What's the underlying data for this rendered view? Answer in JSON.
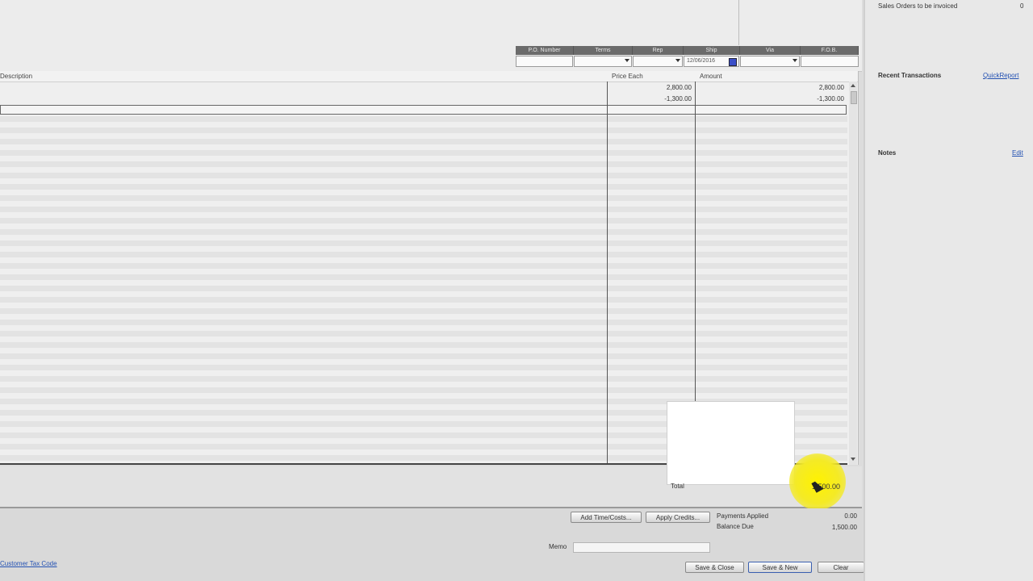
{
  "header_fields": {
    "labels": [
      "P.O. Number",
      "Terms",
      "Rep",
      "Ship",
      "Via",
      "F.O.B."
    ],
    "ship_date": "12/06/2016"
  },
  "grid": {
    "columns": {
      "description": "Description",
      "price_each": "Price Each",
      "amount": "Amount"
    },
    "rows": [
      {
        "price_each": "2,800.00",
        "amount": "2,800.00"
      },
      {
        "price_each": "-1,300.00",
        "amount": "-1,300.00"
      }
    ]
  },
  "totals": {
    "total_label": "Total",
    "total_value": "1,500.00",
    "payments_applied_label": "Payments Applied",
    "payments_applied_value": "0.00",
    "balance_due_label": "Balance Due",
    "balance_due_value": "1,500.00"
  },
  "buttons": {
    "add_time_costs": "Add Time/Costs...",
    "apply_credits": "Apply Credits...",
    "save_close": "Save & Close",
    "save_new": "Save & New",
    "clear": "Clear"
  },
  "memo": {
    "label": "Memo",
    "value": ""
  },
  "customer_tax_code_link": "Customer Tax Code",
  "right_panel": {
    "sales_orders_text": "Sales Orders to be invoiced",
    "recent_transactions_title": "Recent Transactions",
    "quickreport_link": "QuickReport",
    "notes_title": "Notes",
    "edit_link": "Edit"
  },
  "colors": {
    "cursor_highlight": "#f4ea27",
    "accent_blue": "#3b4fc8"
  }
}
